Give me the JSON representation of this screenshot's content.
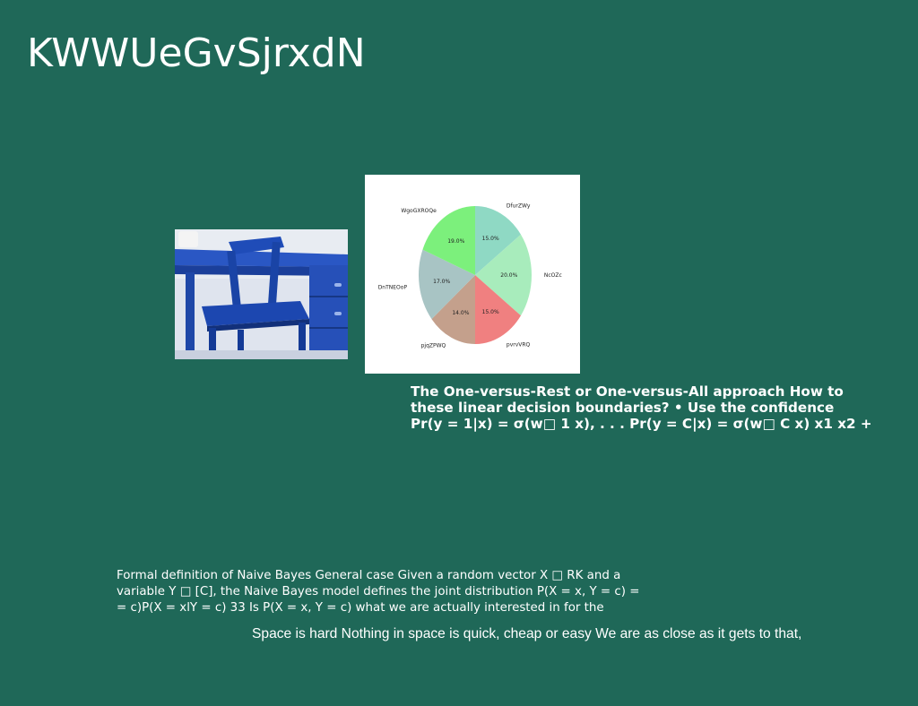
{
  "slide": {
    "title": "KWWUeGvSjrxdN",
    "bold_lines": [
      "The One-versus-Rest or One-versus-All approach How to",
      "these linear decision boundaries? • Use the confidence",
      "Pr(y = 1|x) = σ(w□ 1 x), . . . Pr(y = C|x) = σ(w□ C x) x1 x2 +"
    ],
    "nb_lines": [
      "Formal definition of Naive Bayes General case Given a random vector X □ RK and a",
      "variable Y □ [C], the Naive Bayes model defines the joint distribution P(X = x, Y = c) =",
      "= c)P(X = xlY = c) 33 Is P(X = x, Y = c) what we are actually interested in for the"
    ],
    "space_line": "Space is hard Nothing in space is quick, cheap or easy We are as close as it gets to that,"
  },
  "chart_data": {
    "type": "pie",
    "title": "",
    "slices": [
      {
        "label": "DfurZWy",
        "value": 15.0,
        "pct_label": "15.0%",
        "color": "#8fd9c4"
      },
      {
        "label": "NcOZc",
        "value": 20.0,
        "pct_label": "20.0%",
        "color": "#a8ecbc"
      },
      {
        "label": "pvrvVRQ",
        "value": 15.0,
        "pct_label": "15.0%",
        "color": "#f08080"
      },
      {
        "label": "pjqZPWQ",
        "value": 14.0,
        "pct_label": "14.0%",
        "color": "#c4a08c"
      },
      {
        "label": "DnTNEOoP",
        "value": 17.0,
        "pct_label": "17.0%",
        "color": "#a8c4c4"
      },
      {
        "label": "WgoGXROQe",
        "value": 19.0,
        "pct_label": "19.0%",
        "color": "#7cf07c"
      }
    ],
    "start_angle_deg": 90,
    "direction": "clockwise"
  },
  "colors": {
    "background": "#1f6858",
    "text": "#ffffff",
    "chart_background": "#ffffff"
  }
}
